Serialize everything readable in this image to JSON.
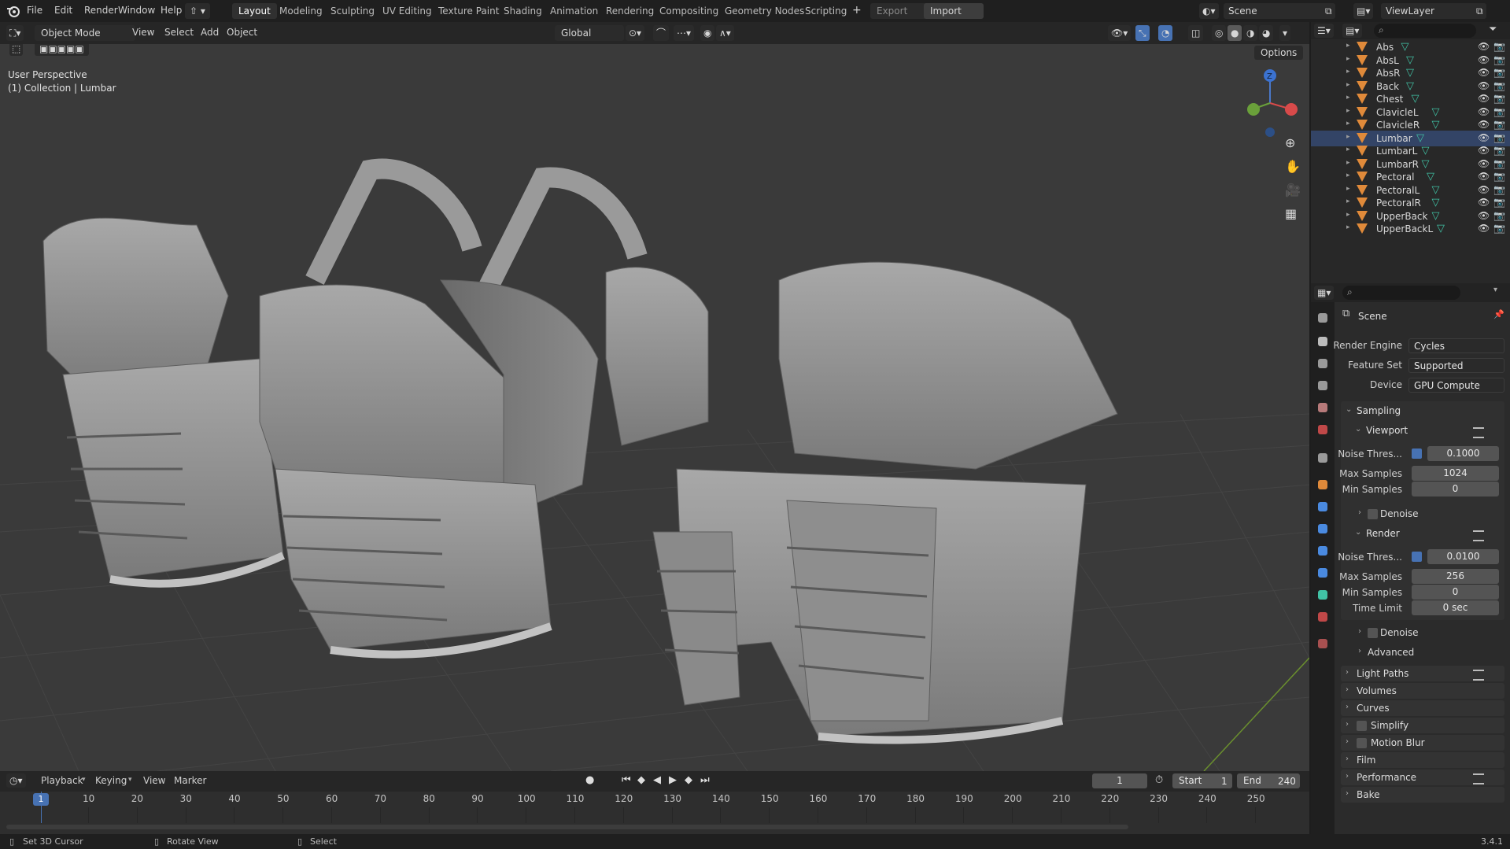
{
  "topbar": {
    "menus": [
      "File",
      "Edit",
      "Render",
      "Window",
      "Help"
    ],
    "workspaces": [
      "Layout",
      "Modeling",
      "Sculpting",
      "UV Editing",
      "Texture Paint",
      "Shading",
      "Animation",
      "Rendering",
      "Compositing",
      "Geometry Nodes",
      "Scripting"
    ],
    "active_workspace": "Layout",
    "add_tab": "+",
    "export_label": "Export",
    "import_label": "Import",
    "scene_name": "Scene",
    "view_layer": "ViewLayer"
  },
  "viewport_header": {
    "mode": "Object Mode",
    "menus": [
      "View",
      "Select",
      "Add",
      "Object"
    ],
    "orientation": "Global",
    "options": "Options"
  },
  "viewport": {
    "perspective": "User Perspective",
    "collection": "(1) Collection | Lumbar",
    "gizmo_z": "Z"
  },
  "outliner": {
    "items": [
      "Abs",
      "AbsL",
      "AbsR",
      "Back",
      "Chest",
      "ClavicleL",
      "ClavicleR",
      "Lumbar",
      "LumbarL",
      "LumbarR",
      "Pectoral",
      "PectoralL",
      "PectoralR",
      "UpperBack",
      "UpperBackL"
    ],
    "selected": "Lumbar"
  },
  "properties": {
    "context": "Scene",
    "render_engine_label": "Render Engine",
    "render_engine": "Cycles",
    "feature_set_label": "Feature Set",
    "feature_set": "Supported",
    "device_label": "Device",
    "device": "GPU Compute",
    "sampling": "Sampling",
    "viewport": {
      "title": "Viewport",
      "noise_label": "Noise Thres...",
      "noise_value": "0.1000",
      "max_label": "Max Samples",
      "max_value": "1024",
      "min_label": "Min Samples",
      "min_value": "0",
      "denoise": "Denoise"
    },
    "render": {
      "title": "Render",
      "noise_label": "Noise Thres...",
      "noise_value": "0.0100",
      "max_label": "Max Samples",
      "max_value": "256",
      "min_label": "Min Samples",
      "min_value": "0",
      "time_label": "Time Limit",
      "time_value": "0 sec",
      "denoise": "Denoise",
      "advanced": "Advanced"
    },
    "panels": [
      "Light Paths",
      "Volumes",
      "Curves",
      "Simplify",
      "Motion Blur",
      "Film",
      "Performance",
      "Bake"
    ]
  },
  "timeline": {
    "menus": [
      "Playback",
      "Keying",
      "View",
      "Marker"
    ],
    "current_frame": "1",
    "start_label": "Start",
    "start": "1",
    "end_label": "End",
    "end": "240",
    "ticks": [
      "10",
      "20",
      "30",
      "40",
      "50",
      "60",
      "70",
      "80",
      "90",
      "100",
      "110",
      "120",
      "130",
      "140",
      "150",
      "160",
      "170",
      "180",
      "190",
      "200",
      "210",
      "220",
      "230",
      "240",
      "250"
    ],
    "playhead": "1"
  },
  "status": {
    "left": "Set 3D Cursor",
    "middle": "Rotate View",
    "right": "Select",
    "version": "3.4.1"
  }
}
